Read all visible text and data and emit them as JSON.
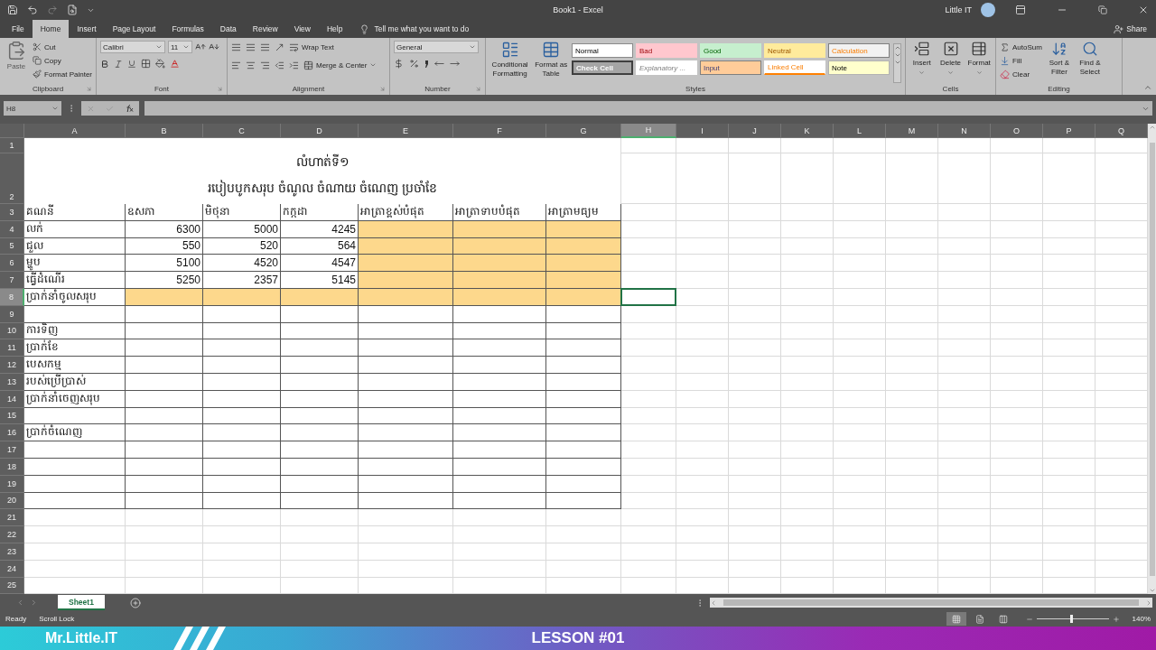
{
  "window": {
    "title": "Book1 - Excel",
    "user": "Little IT"
  },
  "menu_tabs": [
    {
      "label": "File",
      "selected": false
    },
    {
      "label": "Home",
      "selected": true
    },
    {
      "label": "Insert",
      "selected": false
    },
    {
      "label": "Page Layout",
      "selected": false
    },
    {
      "label": "Formulas",
      "selected": false
    },
    {
      "label": "Data",
      "selected": false
    },
    {
      "label": "Review",
      "selected": false
    },
    {
      "label": "View",
      "selected": false
    },
    {
      "label": "Help",
      "selected": false
    }
  ],
  "tell_me": "Tell me what you want to do",
  "share": "Share",
  "ribbon": {
    "clipboard": {
      "label": "Clipboard",
      "paste": {
        "label": "Paste",
        "disabled": true
      },
      "cut": "Cut",
      "copy": "Copy",
      "format_painter": "Format Painter"
    },
    "font": {
      "label": "Font",
      "font_name": "Calibri",
      "font_size": "11"
    },
    "alignment": {
      "label": "Alignment",
      "wrap_text": "Wrap Text",
      "merge": "Merge & Center"
    },
    "number": {
      "label": "Number",
      "format": "General"
    },
    "styles": {
      "label": "Styles",
      "conditional_formatting": "Conditional Formatting",
      "format_as_table": "Format as Table",
      "cell_styles": [
        {
          "label": "Normal",
          "kind": "normal"
        },
        {
          "label": "Bad",
          "kind": "bad"
        },
        {
          "label": "Good",
          "kind": "good"
        },
        {
          "label": "Neutral",
          "kind": "neutral"
        },
        {
          "label": "Calculation",
          "kind": "calculation"
        },
        {
          "label": "Check Cell",
          "kind": "check"
        },
        {
          "label": "Explanatory ...",
          "kind": "explanatory"
        },
        {
          "label": "Input",
          "kind": "input"
        },
        {
          "label": "Linked Cell",
          "kind": "linked"
        },
        {
          "label": "Note",
          "kind": "note"
        }
      ]
    },
    "cells": {
      "label": "Cells",
      "buttons": [
        "Insert",
        "Delete",
        "Format"
      ]
    },
    "editing": {
      "label": "Editing",
      "autosum": "AutoSum",
      "fill": "Fill",
      "clear": "Clear",
      "sort_filter": "Sort & Filter",
      "find_select": "Find & Select"
    }
  },
  "formula_bar": {
    "name_box": "H8"
  },
  "sheet": {
    "columns": [
      {
        "label": "A",
        "selected": false
      },
      {
        "label": "B",
        "selected": false
      },
      {
        "label": "C",
        "selected": false
      },
      {
        "label": "D",
        "selected": false
      },
      {
        "label": "E",
        "selected": false
      },
      {
        "label": "F",
        "selected": false
      },
      {
        "label": "G",
        "selected": false
      },
      {
        "label": "H",
        "selected": true
      },
      {
        "label": "I",
        "selected": false
      },
      {
        "label": "J",
        "selected": false
      },
      {
        "label": "K",
        "selected": false
      },
      {
        "label": "L",
        "selected": false
      },
      {
        "label": "M",
        "selected": false
      },
      {
        "label": "N",
        "selected": false
      },
      {
        "label": "O",
        "selected": false
      },
      {
        "label": "P",
        "selected": false
      },
      {
        "label": "Q",
        "selected": false
      }
    ],
    "title_rows": [
      {
        "number": "1",
        "selected": false
      },
      {
        "number": "2",
        "selected": false
      }
    ],
    "title_lines": [
      "លំហាត់ទី១",
      "របៀបបូកសរុប ចំណូល ចំណាយ ចំណេញ ប្រចាំខែ"
    ],
    "rows": [
      {
        "number": "3",
        "selected": false,
        "kind": "header",
        "cells": [
          {
            "text": "គណនី",
            "filled": false
          },
          {
            "text": "ឧសភា",
            "filled": false
          },
          {
            "text": "មិថុនា",
            "filled": false
          },
          {
            "text": "កក្កដា",
            "filled": false
          },
          {
            "text": "អាត្រាខ្ពស់បំផុត",
            "filled": false
          },
          {
            "text": "អាត្រាទាបបំផុត",
            "filled": false
          },
          {
            "text": "អាត្រាមធ្យម",
            "filled": false
          }
        ]
      },
      {
        "number": "4",
        "selected": false,
        "kind": "data",
        "cells": [
          {
            "text": "លក់",
            "filled": false
          },
          {
            "text": "6300",
            "filled": false
          },
          {
            "text": "5000",
            "filled": false
          },
          {
            "text": "4245",
            "filled": false
          },
          {
            "filled": true
          },
          {
            "filled": true
          },
          {
            "filled": true
          }
        ]
      },
      {
        "number": "5",
        "selected": false,
        "kind": "data",
        "cells": [
          {
            "text": "ជួល",
            "filled": false
          },
          {
            "text": "550",
            "filled": false
          },
          {
            "text": "520",
            "filled": false
          },
          {
            "text": "564",
            "filled": false
          },
          {
            "filled": true
          },
          {
            "filled": true
          },
          {
            "filled": true
          }
        ]
      },
      {
        "number": "6",
        "selected": false,
        "kind": "data",
        "cells": [
          {
            "text": "ម្ហូប",
            "filled": false
          },
          {
            "text": "5100",
            "filled": false
          },
          {
            "text": "4520",
            "filled": false
          },
          {
            "text": "4547",
            "filled": false
          },
          {
            "filled": true
          },
          {
            "filled": true
          },
          {
            "filled": true
          }
        ]
      },
      {
        "number": "7",
        "selected": false,
        "kind": "data",
        "cells": [
          {
            "text": "ធ្វើដំណើរ",
            "filled": false
          },
          {
            "text": "5250",
            "filled": false
          },
          {
            "text": "2357",
            "filled": false
          },
          {
            "text": "5145",
            "filled": false
          },
          {
            "filled": true
          },
          {
            "filled": true
          },
          {
            "filled": true
          }
        ]
      },
      {
        "number": "8",
        "selected": true,
        "kind": "data",
        "cells": [
          {
            "text": "ប្រាក់នាំចូលសរុប",
            "filled": false
          },
          {
            "filled": true
          },
          {
            "filled": true
          },
          {
            "filled": true
          },
          {
            "filled": true
          },
          {
            "filled": true
          },
          {
            "filled": true
          }
        ]
      },
      {
        "number": "9",
        "selected": false,
        "kind": "data",
        "cells": [
          {
            "filled": false
          },
          {
            "filled": false
          },
          {
            "filled": false
          },
          {
            "filled": false
          },
          {
            "filled": false
          },
          {
            "filled": false
          },
          {
            "filled": false
          }
        ]
      },
      {
        "number": "10",
        "selected": false,
        "kind": "data",
        "cells": [
          {
            "text": "ការទិញ",
            "filled": false
          },
          {
            "filled": false
          },
          {
            "filled": false
          },
          {
            "filled": false
          },
          {
            "filled": false
          },
          {
            "filled": false
          },
          {
            "filled": false
          }
        ]
      },
      {
        "number": "11",
        "selected": false,
        "kind": "data",
        "cells": [
          {
            "text": "ប្រាក់ខែ",
            "filled": false
          },
          {
            "filled": false
          },
          {
            "filled": false
          },
          {
            "filled": false
          },
          {
            "filled": false
          },
          {
            "filled": false
          },
          {
            "filled": false
          }
        ]
      },
      {
        "number": "12",
        "selected": false,
        "kind": "data",
        "cells": [
          {
            "text": "បេសកម្ម",
            "filled": false
          },
          {
            "filled": false
          },
          {
            "filled": false
          },
          {
            "filled": false
          },
          {
            "filled": false
          },
          {
            "filled": false
          },
          {
            "filled": false
          }
        ]
      },
      {
        "number": "13",
        "selected": false,
        "kind": "data",
        "cells": [
          {
            "text": "របស់ប្រើប្រាស់",
            "filled": false
          },
          {
            "filled": false
          },
          {
            "filled": false
          },
          {
            "filled": false
          },
          {
            "filled": false
          },
          {
            "filled": false
          },
          {
            "filled": false
          }
        ]
      },
      {
        "number": "14",
        "selected": false,
        "kind": "data",
        "cells": [
          {
            "text": "ប្រាក់នាំចេញសរុប",
            "filled": false
          },
          {
            "filled": false
          },
          {
            "filled": false
          },
          {
            "filled": false
          },
          {
            "filled": false
          },
          {
            "filled": false
          },
          {
            "filled": false
          }
        ]
      },
      {
        "number": "15",
        "selected": false,
        "kind": "data",
        "cells": [
          {
            "filled": false
          },
          {
            "filled": false
          },
          {
            "filled": false
          },
          {
            "filled": false
          },
          {
            "filled": false
          },
          {
            "filled": false
          },
          {
            "filled": false
          }
        ]
      },
      {
        "number": "16",
        "selected": false,
        "kind": "data",
        "cells": [
          {
            "text": "ប្រាក់ចំណេញ",
            "filled": false
          },
          {
            "filled": false
          },
          {
            "filled": false
          },
          {
            "filled": false
          },
          {
            "filled": false
          },
          {
            "filled": false
          },
          {
            "filled": false
          }
        ]
      },
      {
        "number": "17",
        "selected": false,
        "kind": "data",
        "cells": [
          {
            "filled": false
          },
          {
            "filled": false
          },
          {
            "filled": false
          },
          {
            "filled": false
          },
          {
            "filled": false
          },
          {
            "filled": false
          },
          {
            "filled": false
          }
        ]
      },
      {
        "number": "18",
        "selected": false,
        "kind": "data",
        "cells": [
          {
            "filled": false
          },
          {
            "filled": false
          },
          {
            "filled": false
          },
          {
            "filled": false
          },
          {
            "filled": false
          },
          {
            "filled": false
          },
          {
            "filled": false
          }
        ]
      },
      {
        "number": "19",
        "selected": false,
        "kind": "data",
        "cells": [
          {
            "filled": false
          },
          {
            "filled": false
          },
          {
            "filled": false
          },
          {
            "filled": false
          },
          {
            "filled": false
          },
          {
            "filled": false
          },
          {
            "filled": false
          }
        ]
      },
      {
        "number": "20",
        "selected": false,
        "kind": "data",
        "cells": [
          {
            "filled": false
          },
          {
            "filled": false
          },
          {
            "filled": false
          },
          {
            "filled": false
          },
          {
            "filled": false
          },
          {
            "filled": false
          },
          {
            "filled": false
          }
        ]
      },
      {
        "number": "21",
        "selected": false,
        "kind": "plain"
      },
      {
        "number": "22",
        "selected": false,
        "kind": "plain"
      },
      {
        "number": "23",
        "selected": false,
        "kind": "plain"
      },
      {
        "number": "24",
        "selected": false,
        "kind": "plain"
      },
      {
        "number": "25",
        "selected": false,
        "kind": "plain"
      }
    ]
  },
  "sheet_tabs": [
    {
      "label": "Sheet1",
      "selected": true
    }
  ],
  "status_bar": {
    "mode": "Ready",
    "scroll_lock": "Scroll Lock",
    "views": [
      {
        "kind": "normal",
        "selected": true
      },
      {
        "kind": "page_layout",
        "selected": false
      },
      {
        "kind": "page_break",
        "selected": false
      }
    ],
    "zoom_slider": {
      "level": 0.47
    },
    "zoom": "140%"
  },
  "banner": {
    "brand": "Mr.Little.IT",
    "lesson": "LESSON #01"
  }
}
